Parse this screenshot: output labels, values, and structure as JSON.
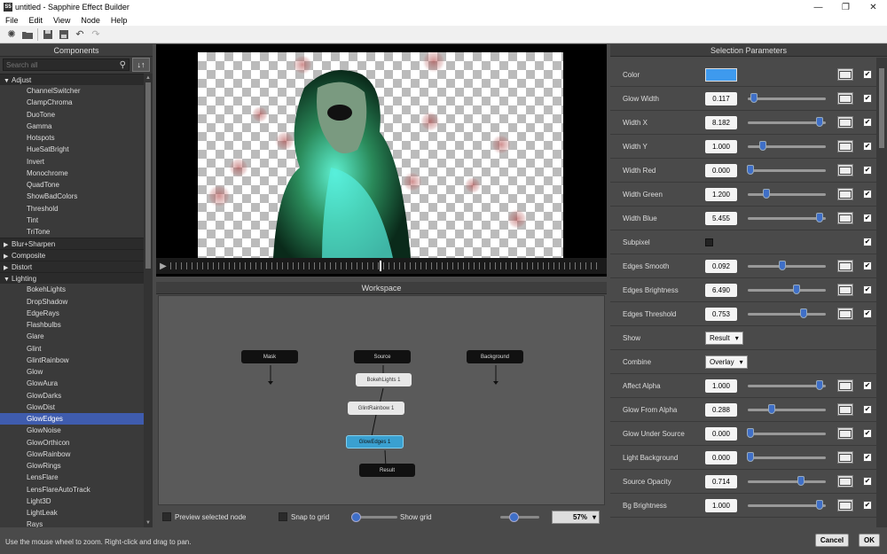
{
  "window": {
    "title": "untitled - Sapphire Effect Builder",
    "app_icon": "S5",
    "minimize": "—",
    "maximize": "❐",
    "close": "✕"
  },
  "menu": [
    "File",
    "Edit",
    "View",
    "Node",
    "Help"
  ],
  "left_panel": {
    "title": "Components",
    "search_placeholder": "Search all",
    "sort_label": "↓↑",
    "tree": [
      {
        "type": "cat",
        "label": "Adjust",
        "open": true
      },
      {
        "type": "leaf",
        "label": "ChannelSwitcher"
      },
      {
        "type": "leaf",
        "label": "ClampChroma"
      },
      {
        "type": "leaf",
        "label": "DuoTone"
      },
      {
        "type": "leaf",
        "label": "Gamma"
      },
      {
        "type": "leaf",
        "label": "Hotspots"
      },
      {
        "type": "leaf",
        "label": "HueSatBright"
      },
      {
        "type": "leaf",
        "label": "Invert"
      },
      {
        "type": "leaf",
        "label": "Monochrome"
      },
      {
        "type": "leaf",
        "label": "QuadTone"
      },
      {
        "type": "leaf",
        "label": "ShowBadColors"
      },
      {
        "type": "leaf",
        "label": "Threshold"
      },
      {
        "type": "leaf",
        "label": "Tint"
      },
      {
        "type": "leaf",
        "label": "TriTone"
      },
      {
        "type": "cat",
        "label": "Blur+Sharpen",
        "open": false
      },
      {
        "type": "cat",
        "label": "Composite",
        "open": false
      },
      {
        "type": "cat",
        "label": "Distort",
        "open": false
      },
      {
        "type": "cat",
        "label": "Lighting",
        "open": true
      },
      {
        "type": "leaf",
        "label": "BokehLights"
      },
      {
        "type": "leaf",
        "label": "DropShadow"
      },
      {
        "type": "leaf",
        "label": "EdgeRays"
      },
      {
        "type": "leaf",
        "label": "Flashbulbs"
      },
      {
        "type": "leaf",
        "label": "Glare"
      },
      {
        "type": "leaf",
        "label": "Glint"
      },
      {
        "type": "leaf",
        "label": "GlintRainbow"
      },
      {
        "type": "leaf",
        "label": "Glow"
      },
      {
        "type": "leaf",
        "label": "GlowAura"
      },
      {
        "type": "leaf",
        "label": "GlowDarks"
      },
      {
        "type": "leaf",
        "label": "GlowDist"
      },
      {
        "type": "leaf",
        "label": "GlowEdges",
        "selected": true
      },
      {
        "type": "leaf",
        "label": "GlowNoise"
      },
      {
        "type": "leaf",
        "label": "GlowOrthicon"
      },
      {
        "type": "leaf",
        "label": "GlowRainbow"
      },
      {
        "type": "leaf",
        "label": "GlowRings"
      },
      {
        "type": "leaf",
        "label": "LensFlare"
      },
      {
        "type": "leaf",
        "label": "LensFlareAutoTrack"
      },
      {
        "type": "leaf",
        "label": "Light3D"
      },
      {
        "type": "leaf",
        "label": "LightLeak"
      },
      {
        "type": "leaf",
        "label": "Rays"
      }
    ]
  },
  "workspace": {
    "title": "Workspace",
    "nodes": {
      "mask": "Mask",
      "source": "Source",
      "background": "Background",
      "bokeh": "BokehLights 1",
      "glint": "GlintRainbow 1",
      "glow": "GlowEdges 1",
      "result": "Result"
    },
    "preview_selected_label": "Preview selected node",
    "snap_label": "Snap to grid",
    "show_grid_label": "Show grid",
    "grid_level": 0.1,
    "zoom_level": 0.35,
    "zoom_value": "57%"
  },
  "right_panel": {
    "title": "Selection Parameters",
    "params": [
      {
        "kind": "color",
        "label": "Color",
        "color": "#3e9aee",
        "key": true,
        "check": true
      },
      {
        "kind": "slider",
        "label": "Glow Width",
        "value": "0.117",
        "pos": 0.05
      },
      {
        "kind": "slider",
        "label": "Width X",
        "value": "8.182",
        "pos": 0.97
      },
      {
        "kind": "slider",
        "label": "Width Y",
        "value": "1.000",
        "pos": 0.18
      },
      {
        "kind": "slider",
        "label": "Width Red",
        "value": "0.000",
        "pos": 0.0
      },
      {
        "kind": "slider",
        "label": "Width Green",
        "value": "1.200",
        "pos": 0.22
      },
      {
        "kind": "slider",
        "label": "Width Blue",
        "value": "5.455",
        "pos": 0.97
      },
      {
        "kind": "bool",
        "label": "Subpixel"
      },
      {
        "kind": "slider",
        "label": "Edges Smooth",
        "value": "0.092",
        "pos": 0.45
      },
      {
        "kind": "slider",
        "label": "Edges Brightness",
        "value": "6.490",
        "pos": 0.65
      },
      {
        "kind": "slider",
        "label": "Edges Threshold",
        "value": "0.753",
        "pos": 0.75
      },
      {
        "kind": "dropdown",
        "label": "Show",
        "value": "Result"
      },
      {
        "kind": "dropdown",
        "label": "Combine",
        "value": "Overlay"
      },
      {
        "kind": "slider",
        "label": "Affect Alpha",
        "value": "1.000",
        "pos": 0.97
      },
      {
        "kind": "slider",
        "label": "Glow From Alpha",
        "value": "0.288",
        "pos": 0.3
      },
      {
        "kind": "slider",
        "label": "Glow Under Source",
        "value": "0.000",
        "pos": 0.0
      },
      {
        "kind": "slider",
        "label": "Light Background",
        "value": "0.000",
        "pos": 0.0
      },
      {
        "kind": "slider",
        "label": "Source Opacity",
        "value": "0.714",
        "pos": 0.71
      },
      {
        "kind": "slider",
        "label": "Bg Brightness",
        "value": "1.000",
        "pos": 0.97
      }
    ]
  },
  "status": {
    "hint": "Use the mouse wheel to zoom.  Right-click and drag to pan.",
    "cancel": "Cancel",
    "ok": "OK"
  }
}
